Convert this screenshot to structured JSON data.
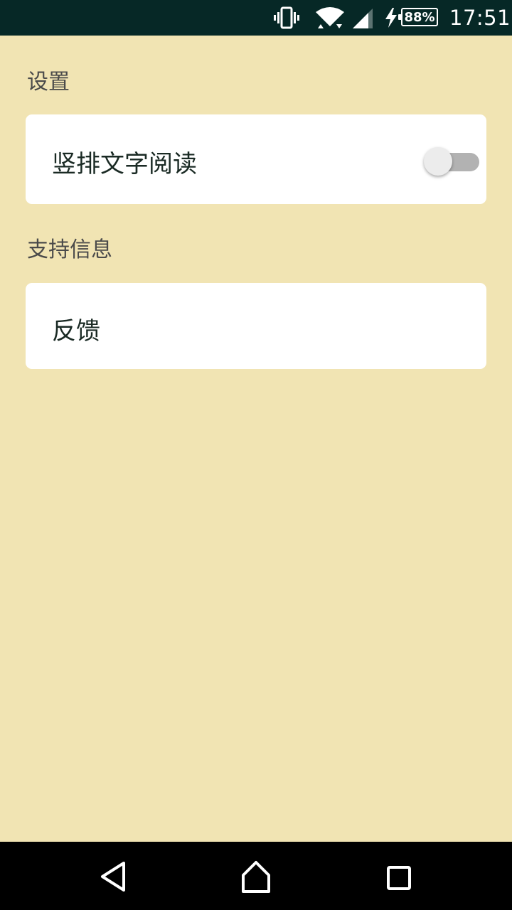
{
  "status_bar": {
    "battery_percent": "88%",
    "time": "17:51",
    "icons": [
      "vibrate-icon",
      "wifi-icon",
      "signal-icon",
      "charging-icon",
      "battery-icon"
    ]
  },
  "sections": {
    "settings": {
      "title": "设置",
      "vertical_reading": {
        "label": "竖排文字阅读",
        "toggle_on": false
      }
    },
    "support": {
      "title": "支持信息",
      "feedback": {
        "label": "反馈"
      }
    }
  },
  "nav_bar": {
    "icons": [
      "back-icon",
      "home-icon",
      "recents-icon"
    ]
  },
  "colors": {
    "background": "#f1e4b3",
    "status_bar": "#062826",
    "card": "#ffffff",
    "toggle_track_off": "#b2b2b2",
    "toggle_thumb_off": "#ececec"
  }
}
